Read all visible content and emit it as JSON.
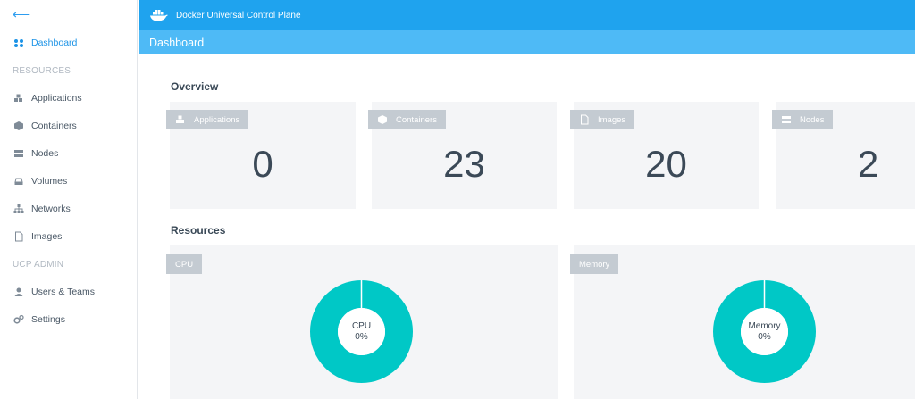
{
  "sidebar": {
    "back_label": "⟵",
    "dashboard": "Dashboard",
    "resources_header": "RESOURCES",
    "items": [
      "Applications",
      "Containers",
      "Nodes",
      "Volumes",
      "Networks",
      "Images"
    ],
    "admin_header": "UCP ADMIN",
    "admin_items": [
      "Users & Teams",
      "Settings"
    ]
  },
  "header": {
    "app_title": "Docker Universal Control Plane",
    "page_title": "Dashboard"
  },
  "overview": {
    "title": "Overview",
    "cards": [
      {
        "label": "Applications",
        "value": "0"
      },
      {
        "label": "Containers",
        "value": "23"
      },
      {
        "label": "Images",
        "value": "20"
      },
      {
        "label": "Nodes",
        "value": "2"
      }
    ]
  },
  "resources": {
    "title": "Resources",
    "cpu": {
      "label": "CPU",
      "center_label": "CPU",
      "percent_text": "0%",
      "percent": 0
    },
    "memory": {
      "label": "Memory",
      "center_label": "Memory",
      "percent_text": "0%",
      "percent": 0
    }
  },
  "colors": {
    "accent": "#1fa3ee",
    "subbar": "#4ebaf6",
    "donut": "#00c8c6",
    "active": "#1c93e6"
  }
}
